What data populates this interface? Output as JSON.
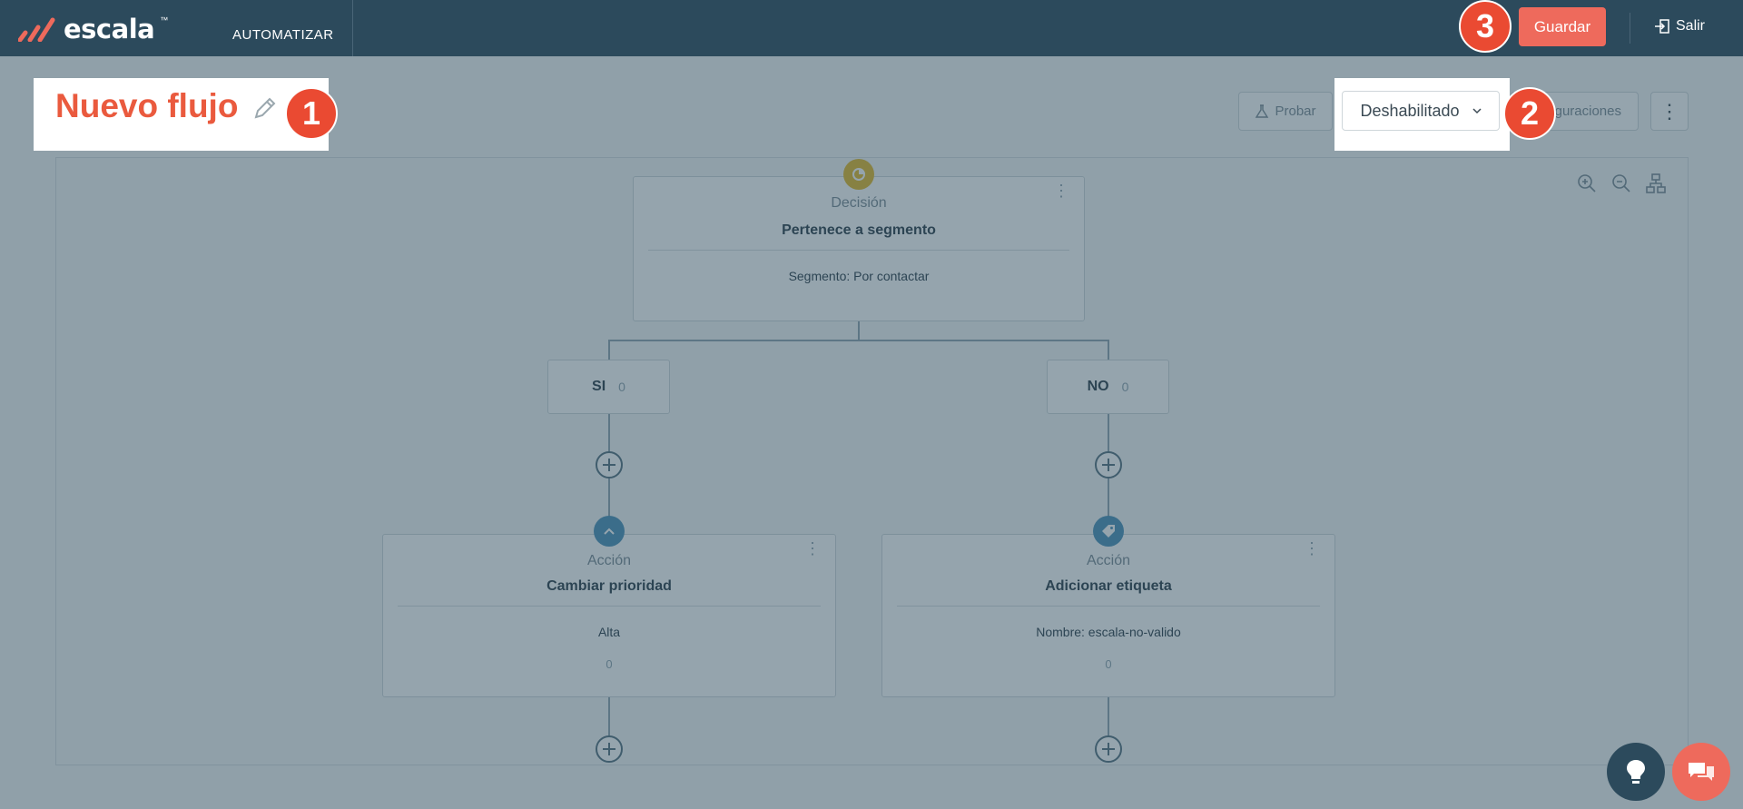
{
  "app": {
    "logo": "escala",
    "logo_tm": "™",
    "nav_item": "AUTOMATIZAR",
    "save_label": "Guardar",
    "exit_label": "Salir"
  },
  "flow": {
    "title": "Nuevo flujo",
    "test_label": "Probar",
    "status_value": "Deshabilitado",
    "config_label": "guraciones",
    "more_label": "⋮"
  },
  "tree": {
    "decision": {
      "head": "Decisión",
      "title": "Pertenece a segmento",
      "body": "Segmento: Por contactar"
    },
    "branches": [
      {
        "label": "SI",
        "count": "0"
      },
      {
        "label": "NO",
        "count": "0"
      }
    ],
    "actions": [
      {
        "head": "Acción",
        "title": "Cambiar prioridad",
        "body": "Alta",
        "count": "0"
      },
      {
        "head": "Acción",
        "title": "Adicionar etiqueta",
        "body": "Nombre: escala-no-valido",
        "count": "0"
      }
    ]
  },
  "callouts": [
    "1",
    "2",
    "3"
  ],
  "icons": {
    "decision": "segment-chart-icon",
    "action_left": "chevron-up-icon",
    "action_right": "tag-icon",
    "help": "lightbulb-icon",
    "chat": "chat-icon"
  },
  "colors": {
    "topbar": "#2c4a5c",
    "accent": "#ee6a5c",
    "title": "#ea5a3e",
    "decision_icon": "#e3b92a",
    "action_icon": "#4a90b8"
  }
}
